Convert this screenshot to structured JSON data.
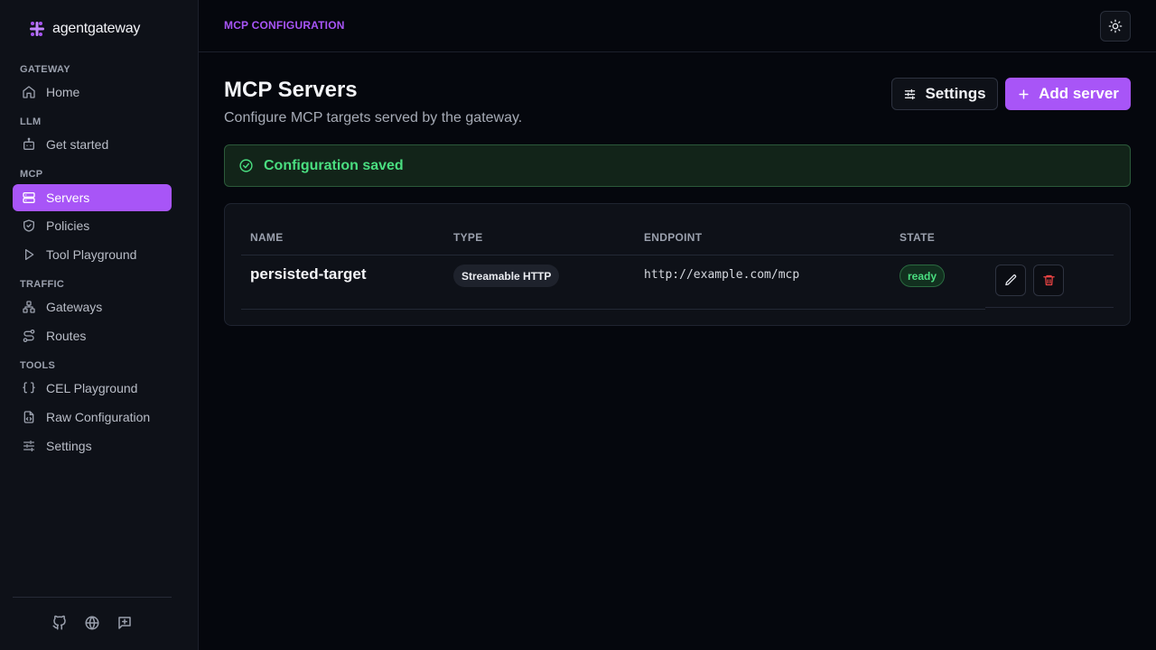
{
  "brand": {
    "name": "agentgateway",
    "accent": "#a855f7"
  },
  "sidebar": {
    "sections": [
      {
        "label": "GATEWAY",
        "items": [
          {
            "label": "Home",
            "icon": "home-icon"
          }
        ]
      },
      {
        "label": "LLM",
        "items": [
          {
            "label": "Get started",
            "icon": "bot-icon"
          }
        ]
      },
      {
        "label": "MCP",
        "items": [
          {
            "label": "Servers",
            "icon": "server-icon",
            "active": true
          },
          {
            "label": "Policies",
            "icon": "shield-icon"
          },
          {
            "label": "Tool Playground",
            "icon": "play-icon"
          }
        ]
      },
      {
        "label": "TRAFFIC",
        "items": [
          {
            "label": "Gateways",
            "icon": "network-icon"
          },
          {
            "label": "Routes",
            "icon": "route-icon"
          }
        ]
      },
      {
        "label": "TOOLS",
        "items": [
          {
            "label": "CEL Playground",
            "icon": "braces-icon"
          },
          {
            "label": "Raw Configuration",
            "icon": "file-code-icon"
          },
          {
            "label": "Settings",
            "icon": "sliders-icon"
          }
        ]
      }
    ],
    "footer_icons": [
      "github-icon",
      "globe-icon",
      "feedback-icon"
    ]
  },
  "topbar": {
    "breadcrumb": "MCP CONFIGURATION",
    "theme_icon": "sun-icon"
  },
  "main": {
    "title": "MCP Servers",
    "subtitle": "Configure MCP targets served by the gateway.",
    "settings_label": "Settings",
    "add_label": "Add server",
    "alert": {
      "text": "Configuration saved",
      "color": "#4ade80"
    },
    "table": {
      "columns": [
        "NAME",
        "TYPE",
        "ENDPOINT",
        "STATE"
      ],
      "rows": [
        {
          "name": "persisted-target",
          "type": "Streamable HTTP",
          "endpoint": "http://example.com/mcp",
          "state": "ready"
        }
      ]
    }
  }
}
